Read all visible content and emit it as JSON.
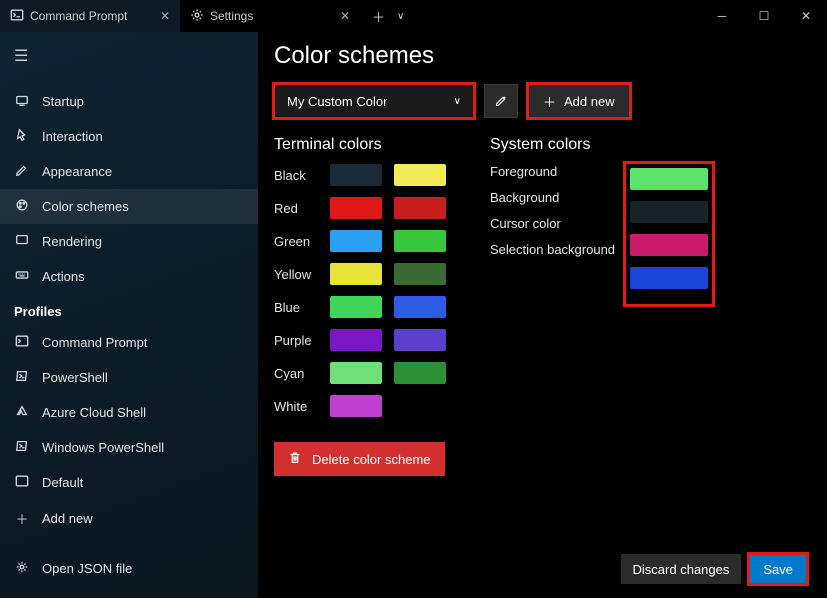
{
  "tabs": [
    {
      "label": "Command Prompt"
    },
    {
      "label": "Settings"
    }
  ],
  "sidebar": {
    "items": [
      {
        "label": "Startup"
      },
      {
        "label": "Interaction"
      },
      {
        "label": "Appearance"
      },
      {
        "label": "Color schemes"
      },
      {
        "label": "Rendering"
      },
      {
        "label": "Actions"
      }
    ],
    "profiles_heading": "Profiles",
    "profiles": [
      {
        "label": "Command Prompt"
      },
      {
        "label": "PowerShell"
      },
      {
        "label": "Azure Cloud Shell"
      },
      {
        "label": "Windows PowerShell"
      },
      {
        "label": "Default"
      },
      {
        "label": "Add new"
      }
    ],
    "footer": {
      "label": "Open JSON file"
    }
  },
  "main": {
    "title": "Color schemes",
    "dropdown_value": "My Custom Color",
    "add_new": "Add new",
    "terminal_heading": "Terminal colors",
    "system_heading": "System colors",
    "delete_label": "Delete color scheme",
    "discard_label": "Discard changes",
    "save_label": "Save",
    "terminal_colors": [
      {
        "name": "Black",
        "a": "#1b2a38",
        "b": "#f2ea57"
      },
      {
        "name": "Red",
        "a": "#e01818",
        "b": "#c81e1e"
      },
      {
        "name": "Green",
        "a": "#2aa0f2",
        "b": "#39c83c"
      },
      {
        "name": "Yellow",
        "a": "#e8e339",
        "b": "#3a6b34"
      },
      {
        "name": "Blue",
        "a": "#3fd657",
        "b": "#2d5be3"
      },
      {
        "name": "Purple",
        "a": "#7a17c7",
        "b": "#5c3fca"
      },
      {
        "name": "Cyan",
        "a": "#6fe078",
        "b": "#2a8f35"
      },
      {
        "name": "White",
        "a": "#c13fd1",
        "b": "#000000"
      }
    ],
    "system_colors": [
      {
        "name": "Foreground",
        "c": "#5be36b"
      },
      {
        "name": "Background",
        "c": "#18242c"
      },
      {
        "name": "Cursor color",
        "c": "#c91a6b"
      },
      {
        "name": "Selection background",
        "c": "#1946d6"
      }
    ]
  }
}
